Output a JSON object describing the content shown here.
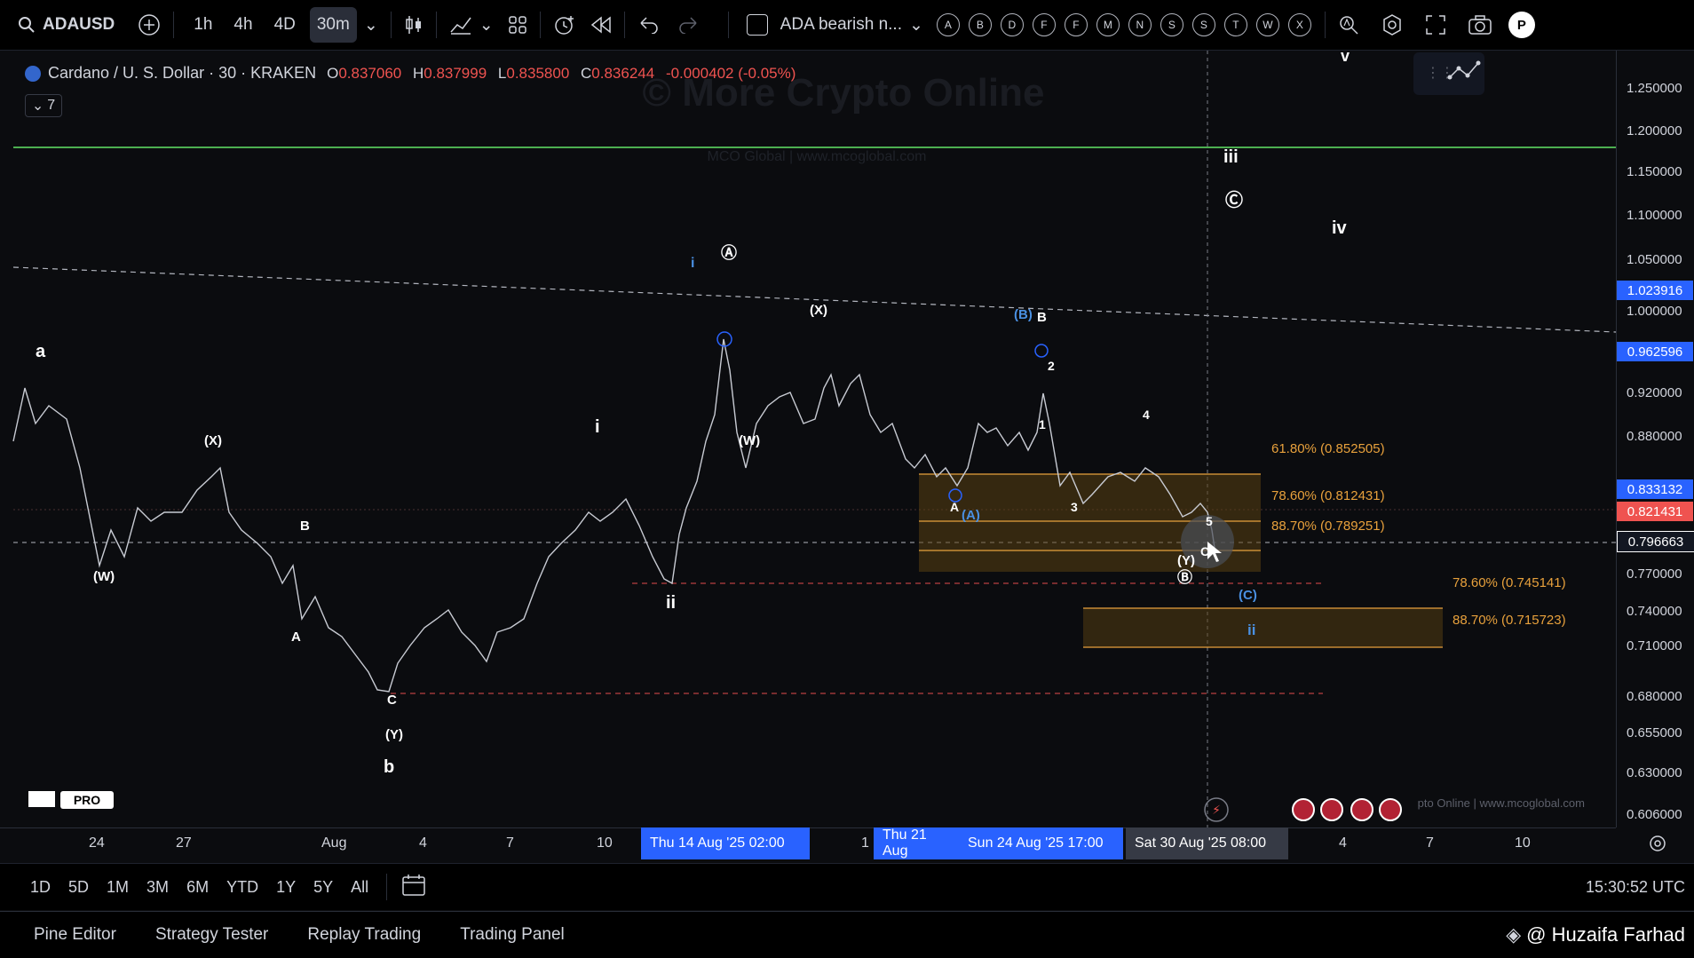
{
  "toolbar": {
    "symbol": "ADAUSD",
    "intervals": [
      "1h",
      "4h",
      "4D",
      "30m"
    ],
    "active_interval": "30m",
    "layout_name": "ADA bearish n...",
    "alert_letters": [
      "A",
      "B",
      "D",
      "F",
      "F",
      "M",
      "N",
      "S",
      "S",
      "T",
      "W",
      "X"
    ]
  },
  "legend": {
    "title": "Cardano / U. S. Dollar · 30 · KRAKEN",
    "o_label": "O",
    "o": "0.837060",
    "h_label": "H",
    "h": "0.837999",
    "l_label": "L",
    "l": "0.835800",
    "c_label": "C",
    "c": "0.836244",
    "change": "-0.000402 (-0.05%)",
    "indicators_count": "7"
  },
  "watermark": {
    "main": "© More Crypto Online",
    "sub": "MCO Global  |  www.mcoglobal.com",
    "bottom": "pto Online  |  www.mcoglobal.com"
  },
  "price_axis": {
    "ticks": [
      "1.250000",
      "1.200000",
      "1.150000",
      "1.100000",
      "1.050000",
      "1.000000",
      "0.920000",
      "0.880000",
      "0.770000",
      "0.740000",
      "0.710000",
      "0.680000",
      "0.655000",
      "0.630000",
      "0.606000"
    ],
    "tags": [
      {
        "label": "1.023916",
        "color": "#2962ff"
      },
      {
        "label": "0.962596",
        "color": "#2962ff"
      },
      {
        "label": "0.833132",
        "color": "#2962ff"
      },
      {
        "label": "0.821431",
        "color": "#ef5350"
      },
      {
        "label": "0.796663",
        "color": "#131722"
      }
    ]
  },
  "fib_levels": [
    {
      "label": "61.80% (0.852505)"
    },
    {
      "label": "78.60% (0.812431)"
    },
    {
      "label": "88.70% (0.789251)"
    },
    {
      "label": "78.60% (0.745141)"
    },
    {
      "label": "88.70% (0.715723)"
    }
  ],
  "wave_labels": [
    "a",
    "(X)",
    "(W)",
    "B",
    "A",
    "C",
    "(Y)",
    "b",
    "i",
    "ii",
    "i",
    "Ⓐ",
    "(W)",
    "(X)",
    "(B)",
    "B",
    "2",
    "1",
    "A",
    "(A)",
    "3",
    "4",
    "5",
    "C",
    "(Y)",
    "Ⓑ",
    "(C)",
    "ii",
    "iii",
    "Ⓒ",
    "iv",
    "v"
  ],
  "time_axis": {
    "ticks": [
      "24",
      "27",
      "Aug",
      "4",
      "7",
      "10",
      "1",
      "4",
      "7",
      "10"
    ],
    "highlights": [
      "Thu 14 Aug '25   02:00",
      "Thu 21 Aug",
      "Sun 24 Aug '25   17:00",
      "Sat 30 Aug '25   08:00"
    ]
  },
  "range_buttons": [
    "1D",
    "5D",
    "1M",
    "3M",
    "6M",
    "YTD",
    "1Y",
    "5Y",
    "All"
  ],
  "clock": "15:30:52 UTC",
  "footer_tabs": [
    "Pine Editor",
    "Strategy Tester",
    "Replay Trading",
    "Trading Panel"
  ],
  "credit": "@ Huzaifa Farhad",
  "logo_text": "PRO",
  "colors": {
    "bg": "#0b0c0f",
    "up": "#d1d4dc",
    "fib": "#e8a13c",
    "accent": "#2962ff",
    "resistance": "#4caf50"
  }
}
